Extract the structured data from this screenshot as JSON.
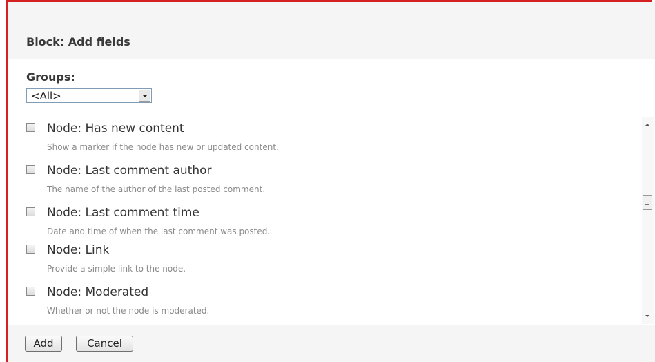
{
  "dialog": {
    "title": "Block: Add fields",
    "groups_label": "Groups:",
    "groups_select": {
      "selected": "<All>"
    }
  },
  "fields": [
    {
      "label": "Node: Has new content",
      "description": "Show a marker if the node has new or updated content.",
      "checked": false
    },
    {
      "label": "Node: Last comment author",
      "description": "The name of the author of the last posted comment.",
      "checked": false
    },
    {
      "label": "Node: Last comment time",
      "description": "Date and time of when the last comment was posted.",
      "checked": false
    },
    {
      "label": "Node: Link",
      "description": "Provide a simple link to the node.",
      "checked": false
    },
    {
      "label": "Node: Moderated",
      "description": "Whether or not the node is moderated.",
      "checked": false
    }
  ],
  "buttons": {
    "add": "Add",
    "cancel": "Cancel"
  },
  "colors": {
    "frame_border": "#d42020",
    "header_bg": "#f5f5f5"
  }
}
